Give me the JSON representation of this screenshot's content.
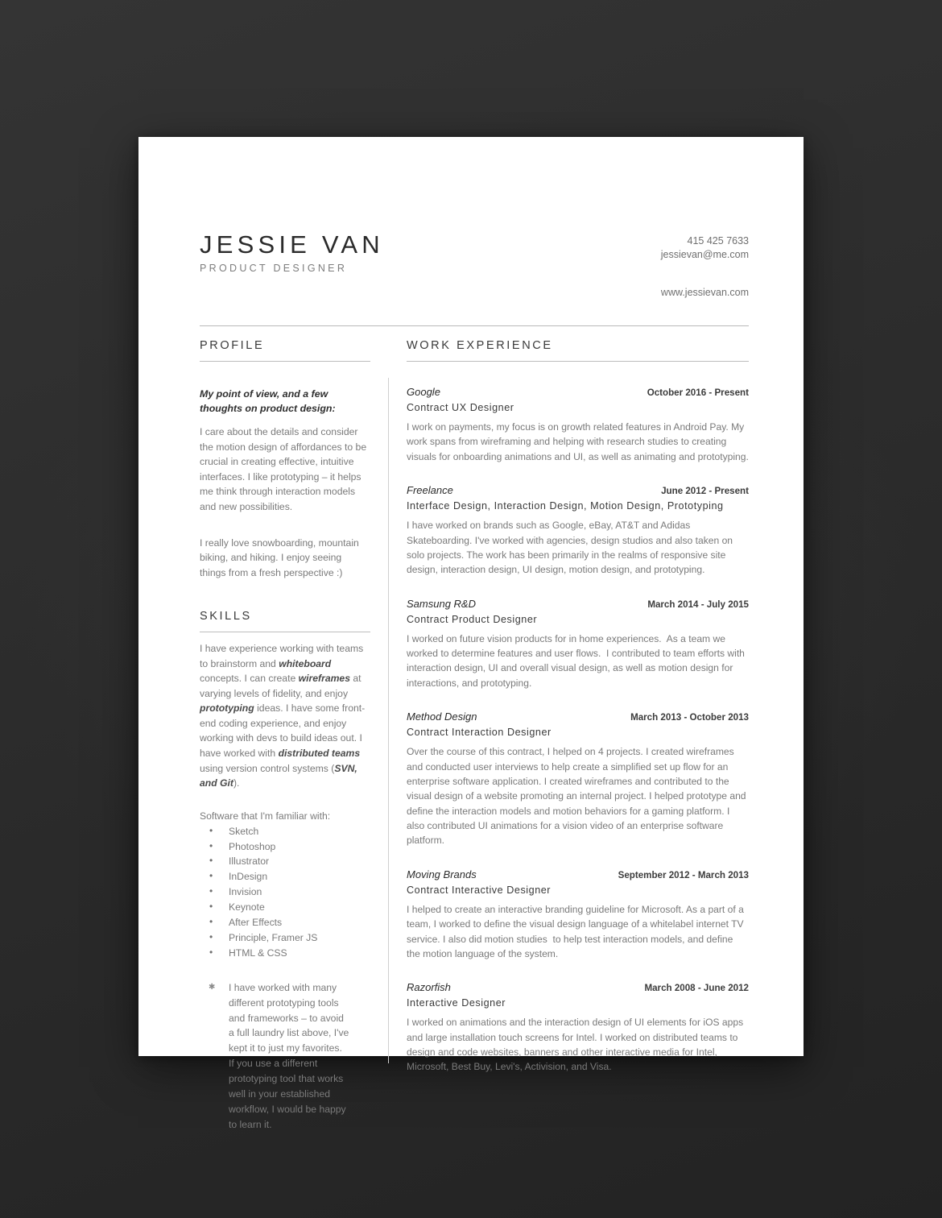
{
  "theme": {
    "page_background": "#ffffff",
    "backdrop": "#2e2e2e",
    "heading_color": "#3a3a3a",
    "body_color": "#7a7a7a",
    "rule_color": "#bdbdbd"
  },
  "header": {
    "name": "JESSIE VAN",
    "role": "PRODUCT DESIGNER",
    "phone": "415 425 7633",
    "email": "jessievan@me.com",
    "website": "www.jessievan.com"
  },
  "profile": {
    "heading": "PROFILE",
    "lead": "My point of view, and a few thoughts on product design:",
    "paragraph_1": "I care about the details and consider the motion design of affordances to be crucial in creating effective, intuitive interfaces. I like prototyping – it helps me think through interaction models and new possibilities.",
    "paragraph_2": "I really love snowboarding, mountain biking, and hiking. I enjoy seeing things from a fresh perspective :)"
  },
  "skills": {
    "heading": "SKILLS",
    "paragraph_segments": [
      {
        "text": "I have experience working with teams to brainstorm and ",
        "emphasis": false
      },
      {
        "text": "whiteboard",
        "emphasis": true
      },
      {
        "text": " concepts. I can create ",
        "emphasis": false
      },
      {
        "text": "wireframes",
        "emphasis": true
      },
      {
        "text": " at varying levels of fidelity, and enjoy ",
        "emphasis": false
      },
      {
        "text": "prototyping",
        "emphasis": true
      },
      {
        "text": " ideas. I have some front-end coding experience, and enjoy working with devs to build ideas out. I have worked with ",
        "emphasis": false
      },
      {
        "text": "distributed teams",
        "emphasis": true
      },
      {
        "text": " using version control systems (",
        "emphasis": false
      },
      {
        "text": "SVN, and Git",
        "emphasis": true
      },
      {
        "text": ").",
        "emphasis": false
      }
    ],
    "software_label": "Software that I'm familiar with:",
    "software": [
      "Sketch",
      "Photoshop",
      "Illustrator",
      "InDesign",
      "Invision",
      "Keynote",
      "After Effects",
      "Principle, Framer JS",
      "HTML & CSS"
    ],
    "note": "I have worked with many different prototyping tools and frameworks – to avoid a full laundry list above, I've kept it to just my favorites. If you use a different prototyping tool that works well in your established workflow, I would be happy to learn it."
  },
  "work": {
    "heading": "WORK EXPERIENCE",
    "jobs": [
      {
        "company": "Google",
        "dates": "October 2016 - Present",
        "title": "Contract UX Designer",
        "description": "I work on payments, my focus is on growth related features in Android Pay. My work spans from wireframing and helping with research studies to creating visuals for onboarding animations and UI, as well as animating and prototyping."
      },
      {
        "company": "Freelance",
        "dates": "June 2012 - Present",
        "title": "Interface Design, Interaction Design,  Motion Design, Prototyping",
        "description": "I have worked on brands such as Google, eBay, AT&T and Adidas Skateboarding. I've worked with agencies, design studios and also taken on solo projects. The work has been primarily in the realms of responsive site design, interaction design, UI design, motion design, and prototyping."
      },
      {
        "company": "Samsung R&D",
        "dates": "March 2014 - July 2015",
        "title": "Contract Product Designer",
        "description": "I worked on future vision products for in home experiences.  As a team we worked to determine features and user flows.  I contributed to team efforts with interaction design, UI and overall visual design, as well as motion design for interactions, and prototyping."
      },
      {
        "company": "Method Design",
        "dates": "March 2013 - October 2013",
        "title": "Contract Interaction Designer",
        "description": "Over the course of this contract, I helped on 4 projects. I created wireframes and conducted user interviews to help create a simplified set up flow for an enterprise software application. I created wireframes and contributed to the visual design of a website promoting an internal project. I helped prototype and define the interaction models and motion behaviors for a gaming platform. I also contributed UI animations for a vision video of an enterprise software platform."
      },
      {
        "company": "Moving Brands",
        "dates": "September 2012 - March  2013",
        "title": "Contract Interactive Designer",
        "description": "I helped to create an interactive branding guideline for Microsoft. As a part of a team, I worked to define the visual design language of a whitelabel internet TV service. I also did motion studies  to help test interaction models, and define the motion language of the system."
      },
      {
        "company": "Razorfish",
        "dates": "March 2008 - June  2012",
        "title": "Interactive Designer",
        "description": "I worked on animations and the interaction design of UI elements for iOS apps and large installation touch screens for Intel. I worked on distributed teams to design and code websites, banners and other interactive media for Intel, Microsoft, Best Buy, Levi's, Activision, and Visa."
      }
    ]
  }
}
